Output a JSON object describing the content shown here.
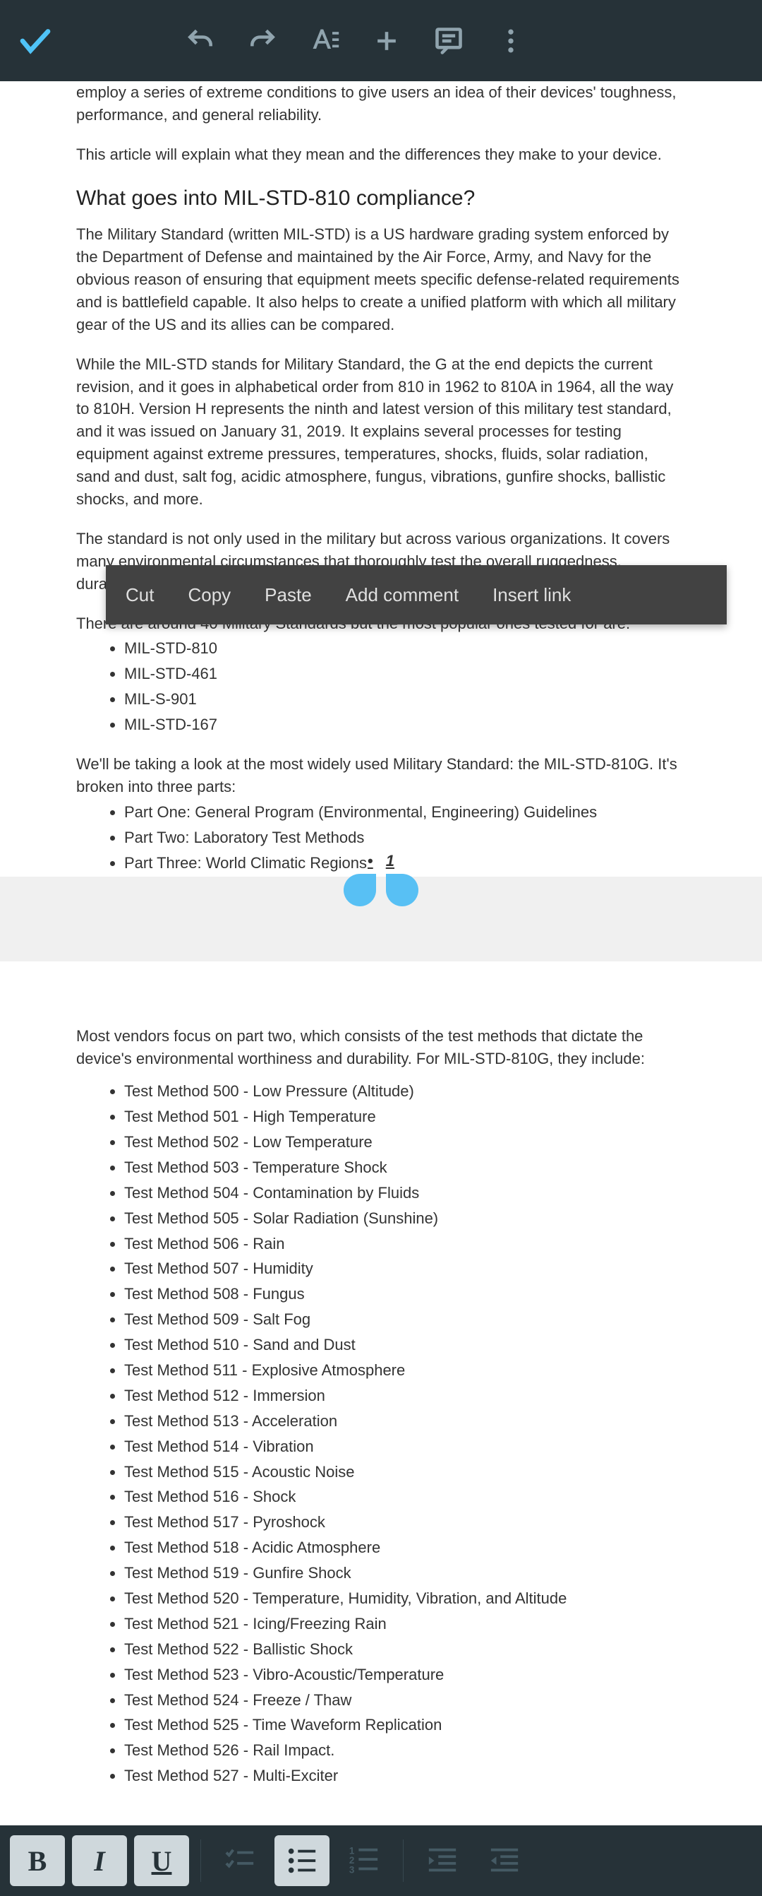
{
  "topbar": {
    "icons": [
      "check-icon",
      "undo-icon",
      "redo-icon",
      "text-format-icon",
      "add-icon",
      "comment-icon",
      "more-vert-icon"
    ]
  },
  "document": {
    "cut_top": "employ a series of extreme conditions to give users an idea of their devices' toughness, performance, and general reliability.",
    "intro2": "This article will explain what they mean and the differences they make to your device.",
    "h2": "What goes into MIL-STD-810 compliance?",
    "p1": "The Military Standard (written MIL-STD) is a US hardware grading system enforced by the Department of Defense and maintained by the Air Force, Army, and Navy for the obvious reason of ensuring that equipment meets specific defense-related requirements and is battlefield capable. It also helps to create a unified platform with which all military gear of the US and its allies can be compared.",
    "p2": "While the MIL-STD stands for Military Standard, the G at the end depicts the current revision, and it goes in alphabetical order from 810 in 1962 to 810A in 1964, all the way to 810H. Version H represents the ninth and latest version of this military test standard, and it was issued on January 31, 2019. It explains several processes for testing equipment against extreme pressures, temperatures, shocks, fluids, solar radiation, sand and dust, salt fog, acidic atmosphere, fungus, vibrations, gunfire shocks, ballistic shocks, and more.",
    "p3": "The standard is not only used in the military but across various organizations. It covers many environmental circumstances that thoroughly test the overall ruggedness, durability, and ability of products to withstand extreme conditions.",
    "p4": "There are around 40 Military Standards but the most popular ones tested for are:",
    "stds": [
      "MIL-STD-810",
      "MIL-STD-461",
      "MIL-S-901",
      "MIL-STD-167"
    ],
    "p5": "We'll be taking a look at the most widely used Military Standard: the MIL-STD-810G. It's broken into three parts:",
    "parts": [
      "Part One: General Program (Environmental, Engineering) Guidelines",
      "Part Two: Laboratory Test Methods",
      "Part Three: World Climatic Regions"
    ],
    "selected_page_num": "1",
    "p_after_break": "Most vendors focus on part two, which consists of the test methods that dictate the device's environmental worthiness and durability. For MIL-STD-810G, they include:",
    "methods": [
      "Test Method 500 - Low Pressure (Altitude)",
      "Test Method 501 - High Temperature",
      "Test Method 502 - Low Temperature",
      "Test Method 503 - Temperature Shock",
      "Test Method 504 - Contamination by Fluids",
      "Test Method 505 - Solar Radiation (Sunshine)",
      "Test Method 506 - Rain",
      "Test Method 507 - Humidity",
      "Test Method 508 - Fungus",
      "Test Method 509 - Salt Fog",
      "Test Method 510 - Sand and Dust",
      "Test Method 511 - Explosive Atmosphere",
      "Test Method 512 - Immersion",
      "Test Method 513 - Acceleration",
      "Test Method 514 - Vibration",
      "Test Method 515 - Acoustic Noise",
      "Test Method 516 - Shock",
      "Test Method 517 - Pyroshock",
      "Test Method 518 - Acidic Atmosphere",
      "Test Method 519 - Gunfire Shock",
      "Test Method 520 - Temperature, Humidity, Vibration, and Altitude",
      "Test Method 521 - Icing/Freezing Rain",
      "Test Method 522 - Ballistic Shock",
      "Test Method 523 - Vibro-Acoustic/Temperature",
      "Test Method 524 - Freeze / Thaw",
      "Test Method 525 - Time Waveform Replication",
      "Test Method 526 - Rail Impact.",
      "Test Method 527 - Multi-Exciter"
    ]
  },
  "context_menu": {
    "items": [
      "Cut",
      "Copy",
      "Paste",
      "Add comment",
      "Insert link"
    ]
  },
  "bottombar": {
    "bold": "B",
    "italic": "I",
    "underline": "U",
    "states": {
      "bold": true,
      "italic": true,
      "underline": true,
      "bulleted": true
    },
    "icons": [
      "checklist-icon",
      "bulleted-list-icon",
      "numbered-list-icon",
      "outdent-icon",
      "indent-icon"
    ]
  }
}
